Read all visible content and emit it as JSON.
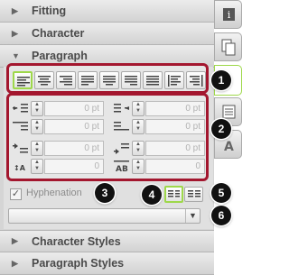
{
  "sections": {
    "fitting": "Fitting",
    "character": "Character",
    "paragraph": "Paragraph",
    "character_styles": "Character Styles",
    "paragraph_styles": "Paragraph Styles"
  },
  "alignment": {
    "buttons": [
      "align-left",
      "align-center",
      "align-right",
      "justify-left",
      "justify-center",
      "justify-right",
      "justify-all",
      "align-towards-spine",
      "align-away-from-spine"
    ],
    "active": "align-left"
  },
  "indents": {
    "left_indent": "0 pt",
    "right_indent": "0 pt",
    "first_line_indent": "0 pt",
    "last_line_indent": "0 pt",
    "space_before": "0 pt",
    "space_after": "0 pt",
    "drop_cap_lines": "0",
    "drop_cap_chars": "0"
  },
  "hyphenation": {
    "label": "Hyphenation",
    "checked": true
  },
  "callouts": [
    "1",
    "2",
    "3",
    "4",
    "5",
    "6"
  ],
  "dropdown": {
    "value": ""
  },
  "sidebar_tabs": [
    "info-icon",
    "pages-icon",
    "layers-icon",
    "text-icon"
  ],
  "colors": {
    "callout_border": "#a3162e",
    "active_green": "#9ed84a",
    "badge_bg": "#111111"
  }
}
